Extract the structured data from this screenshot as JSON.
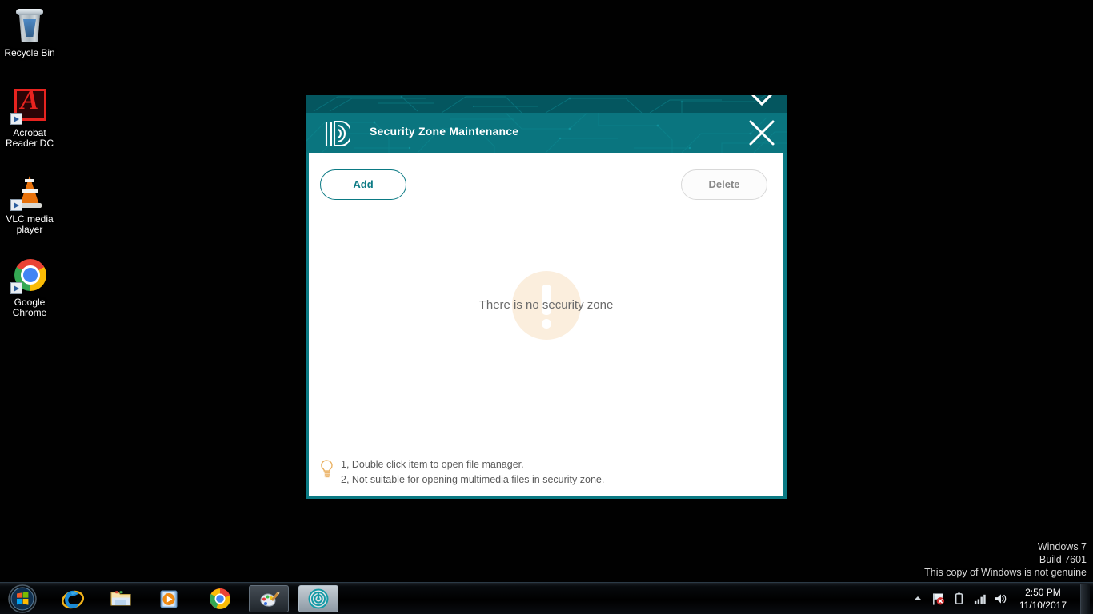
{
  "desktop": {
    "icons": [
      {
        "name": "recycle-bin",
        "label": "Recycle Bin"
      },
      {
        "name": "acrobat",
        "label": "Acrobat\nReader DC"
      },
      {
        "name": "vlc",
        "label": "VLC media\nplayer"
      },
      {
        "name": "chrome",
        "label": "Google\nChrome"
      }
    ],
    "watermark": {
      "line1": "Windows 7",
      "line2": "Build 7601",
      "line3": "This copy of Windows is not genuine"
    },
    "background_color": "#000000"
  },
  "window": {
    "title": "Security Zone Maintenance",
    "logo_icon": "fingerprint-id-icon",
    "close_icon": "close-icon",
    "minimize_icon": "minimize-icon",
    "title_bar_color": "#0a757f",
    "title_strip_color": "#04565f",
    "border_color": "#0b7a84",
    "toolbar": {
      "add_label": "Add",
      "delete_label": "Delete",
      "add_color": "#0b7a84",
      "delete_color": "#888888"
    },
    "empty_state": {
      "message": "There is no security zone",
      "badge_icon": "exclamation-icon",
      "badge_color": "#fbeedd"
    },
    "tips": {
      "icon": "lightbulb-icon",
      "line1": "1, Double click item to open file manager.",
      "line2": "2, Not suitable for opening multimedia files in security zone."
    }
  },
  "taskbar": {
    "start_label": "Start",
    "items": [
      {
        "name": "internet-explorer",
        "label": "Internet Explorer"
      },
      {
        "name": "windows-explorer",
        "label": "Windows Explorer"
      },
      {
        "name": "windows-media-player",
        "label": "Windows Media Player"
      },
      {
        "name": "google-chrome",
        "label": "Google Chrome"
      },
      {
        "name": "paint",
        "label": "Paint"
      },
      {
        "name": "security-zone-app",
        "label": "Security Zone Maintenance"
      }
    ],
    "tray": {
      "chevron_icon": "chevron-up-icon",
      "action_center_icon": "flag-alert-icon",
      "battery_icon": "battery-icon",
      "network_icon": "signal-bars-icon",
      "volume_icon": "speaker-icon",
      "time": "2:50 PM",
      "date": "11/10/2017"
    }
  }
}
